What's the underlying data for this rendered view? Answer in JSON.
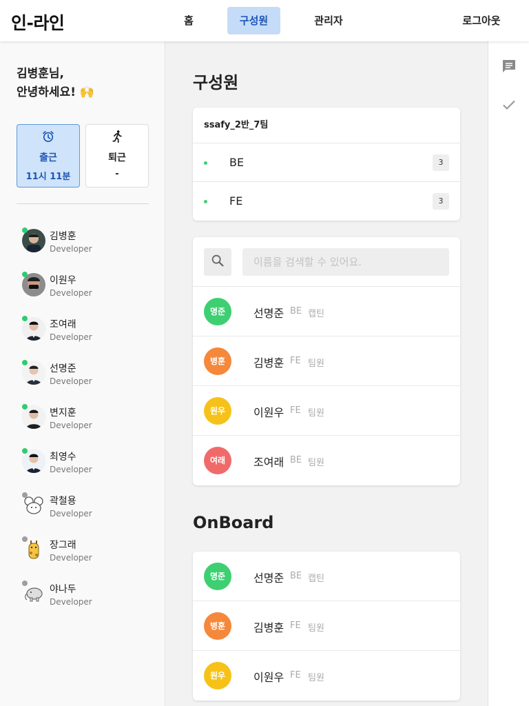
{
  "app": {
    "logo": "인-라인"
  },
  "nav": {
    "home": "홈",
    "members": "구성원",
    "admin": "관리자",
    "logout": "로그아웃"
  },
  "sidebar": {
    "greeting": "김병훈님,\n안녕하세요! 🙌",
    "check_in": {
      "label": "출근",
      "time": "11시 11분",
      "icon": "alarm-clock-icon"
    },
    "check_out": {
      "label": "퇴근",
      "time": "-",
      "icon": "running-person-icon"
    },
    "members": [
      {
        "name": "김병훈",
        "role": "Developer",
        "status": "online",
        "status_color": "#2ecc71"
      },
      {
        "name": "이원우",
        "role": "Developer",
        "status": "online",
        "status_color": "#2ecc71"
      },
      {
        "name": "조여래",
        "role": "Developer",
        "status": "online",
        "status_color": "#2ecc71"
      },
      {
        "name": "선명준",
        "role": "Developer",
        "status": "online",
        "status_color": "#2ecc71"
      },
      {
        "name": "변지훈",
        "role": "Developer",
        "status": "online",
        "status_color": "#2ecc71"
      },
      {
        "name": "최영수",
        "role": "Developer",
        "status": "online",
        "status_color": "#2ecc71"
      },
      {
        "name": "곽철용",
        "role": "Developer",
        "status": "offline",
        "status_color": "#9e9e9e"
      },
      {
        "name": "장그래",
        "role": "Developer",
        "status": "offline",
        "status_color": "#9e9e9e"
      },
      {
        "name": "야나두",
        "role": "Developer",
        "status": "offline",
        "status_color": "#9e9e9e"
      }
    ]
  },
  "main": {
    "members_title": "구성원",
    "team": {
      "name": "ssafy_2반_7팀",
      "groups": [
        {
          "name": "BE",
          "count": "3"
        },
        {
          "name": "FE",
          "count": "3"
        }
      ]
    },
    "search": {
      "placeholder": "이름을 검색할 수 있어요."
    },
    "people": [
      {
        "badge": "명준",
        "name": "선명준",
        "team": "BE",
        "role": "캡틴",
        "color": "#3ecf72"
      },
      {
        "badge": "병훈",
        "name": "김병훈",
        "team": "FE",
        "role": "팀원",
        "color": "#f5883a"
      },
      {
        "badge": "원우",
        "name": "이원우",
        "team": "FE",
        "role": "팀원",
        "color": "#f6c21a"
      },
      {
        "badge": "여래",
        "name": "조여래",
        "team": "BE",
        "role": "팀원",
        "color": "#f16a6a"
      }
    ],
    "onboard_title": "OnBoard",
    "onboard": [
      {
        "badge": "명준",
        "name": "선명준",
        "team": "BE",
        "role": "캡틴",
        "color": "#3ecf72"
      },
      {
        "badge": "병훈",
        "name": "김병훈",
        "team": "FE",
        "role": "팀원",
        "color": "#f5883a"
      },
      {
        "badge": "원우",
        "name": "이원우",
        "team": "FE",
        "role": "팀원",
        "color": "#f6c21a"
      }
    ]
  },
  "rail": {
    "icons": [
      "chat-icon",
      "check-icon"
    ]
  },
  "colors": {
    "accent": "#1d55b5",
    "accent_bg": "#c5dcf8",
    "online": "#2ecc71",
    "offline": "#9e9e9e"
  }
}
